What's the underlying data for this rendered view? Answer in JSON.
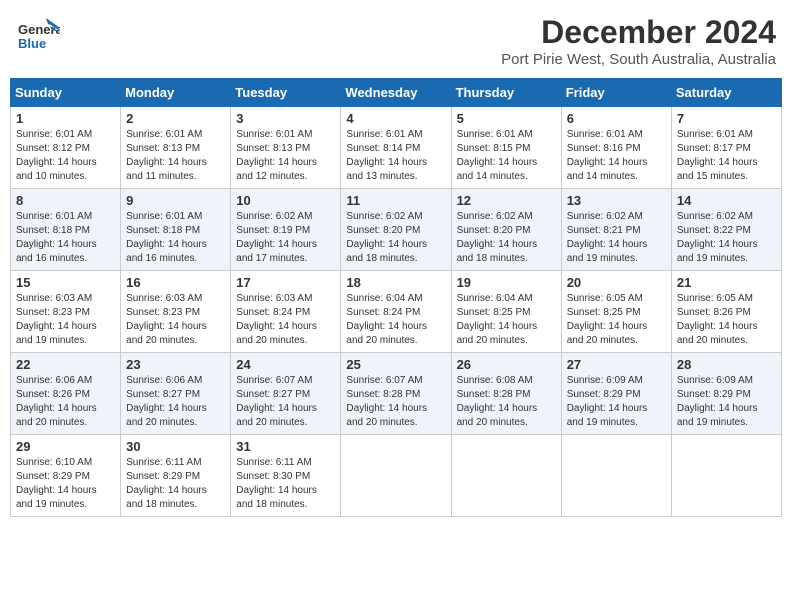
{
  "header": {
    "logo_general": "General",
    "logo_blue": "Blue",
    "title": "December 2024",
    "subtitle": "Port Pirie West, South Australia, Australia"
  },
  "weekdays": [
    "Sunday",
    "Monday",
    "Tuesday",
    "Wednesday",
    "Thursday",
    "Friday",
    "Saturday"
  ],
  "weeks": [
    [
      {
        "day": "1",
        "sunrise": "Sunrise: 6:01 AM",
        "sunset": "Sunset: 8:12 PM",
        "daylight": "Daylight: 14 hours and 10 minutes."
      },
      {
        "day": "2",
        "sunrise": "Sunrise: 6:01 AM",
        "sunset": "Sunset: 8:13 PM",
        "daylight": "Daylight: 14 hours and 11 minutes."
      },
      {
        "day": "3",
        "sunrise": "Sunrise: 6:01 AM",
        "sunset": "Sunset: 8:13 PM",
        "daylight": "Daylight: 14 hours and 12 minutes."
      },
      {
        "day": "4",
        "sunrise": "Sunrise: 6:01 AM",
        "sunset": "Sunset: 8:14 PM",
        "daylight": "Daylight: 14 hours and 13 minutes."
      },
      {
        "day": "5",
        "sunrise": "Sunrise: 6:01 AM",
        "sunset": "Sunset: 8:15 PM",
        "daylight": "Daylight: 14 hours and 14 minutes."
      },
      {
        "day": "6",
        "sunrise": "Sunrise: 6:01 AM",
        "sunset": "Sunset: 8:16 PM",
        "daylight": "Daylight: 14 hours and 14 minutes."
      },
      {
        "day": "7",
        "sunrise": "Sunrise: 6:01 AM",
        "sunset": "Sunset: 8:17 PM",
        "daylight": "Daylight: 14 hours and 15 minutes."
      }
    ],
    [
      {
        "day": "8",
        "sunrise": "Sunrise: 6:01 AM",
        "sunset": "Sunset: 8:18 PM",
        "daylight": "Daylight: 14 hours and 16 minutes."
      },
      {
        "day": "9",
        "sunrise": "Sunrise: 6:01 AM",
        "sunset": "Sunset: 8:18 PM",
        "daylight": "Daylight: 14 hours and 16 minutes."
      },
      {
        "day": "10",
        "sunrise": "Sunrise: 6:02 AM",
        "sunset": "Sunset: 8:19 PM",
        "daylight": "Daylight: 14 hours and 17 minutes."
      },
      {
        "day": "11",
        "sunrise": "Sunrise: 6:02 AM",
        "sunset": "Sunset: 8:20 PM",
        "daylight": "Daylight: 14 hours and 18 minutes."
      },
      {
        "day": "12",
        "sunrise": "Sunrise: 6:02 AM",
        "sunset": "Sunset: 8:20 PM",
        "daylight": "Daylight: 14 hours and 18 minutes."
      },
      {
        "day": "13",
        "sunrise": "Sunrise: 6:02 AM",
        "sunset": "Sunset: 8:21 PM",
        "daylight": "Daylight: 14 hours and 19 minutes."
      },
      {
        "day": "14",
        "sunrise": "Sunrise: 6:02 AM",
        "sunset": "Sunset: 8:22 PM",
        "daylight": "Daylight: 14 hours and 19 minutes."
      }
    ],
    [
      {
        "day": "15",
        "sunrise": "Sunrise: 6:03 AM",
        "sunset": "Sunset: 8:23 PM",
        "daylight": "Daylight: 14 hours and 19 minutes."
      },
      {
        "day": "16",
        "sunrise": "Sunrise: 6:03 AM",
        "sunset": "Sunset: 8:23 PM",
        "daylight": "Daylight: 14 hours and 20 minutes."
      },
      {
        "day": "17",
        "sunrise": "Sunrise: 6:03 AM",
        "sunset": "Sunset: 8:24 PM",
        "daylight": "Daylight: 14 hours and 20 minutes."
      },
      {
        "day": "18",
        "sunrise": "Sunrise: 6:04 AM",
        "sunset": "Sunset: 8:24 PM",
        "daylight": "Daylight: 14 hours and 20 minutes."
      },
      {
        "day": "19",
        "sunrise": "Sunrise: 6:04 AM",
        "sunset": "Sunset: 8:25 PM",
        "daylight": "Daylight: 14 hours and 20 minutes."
      },
      {
        "day": "20",
        "sunrise": "Sunrise: 6:05 AM",
        "sunset": "Sunset: 8:25 PM",
        "daylight": "Daylight: 14 hours and 20 minutes."
      },
      {
        "day": "21",
        "sunrise": "Sunrise: 6:05 AM",
        "sunset": "Sunset: 8:26 PM",
        "daylight": "Daylight: 14 hours and 20 minutes."
      }
    ],
    [
      {
        "day": "22",
        "sunrise": "Sunrise: 6:06 AM",
        "sunset": "Sunset: 8:26 PM",
        "daylight": "Daylight: 14 hours and 20 minutes."
      },
      {
        "day": "23",
        "sunrise": "Sunrise: 6:06 AM",
        "sunset": "Sunset: 8:27 PM",
        "daylight": "Daylight: 14 hours and 20 minutes."
      },
      {
        "day": "24",
        "sunrise": "Sunrise: 6:07 AM",
        "sunset": "Sunset: 8:27 PM",
        "daylight": "Daylight: 14 hours and 20 minutes."
      },
      {
        "day": "25",
        "sunrise": "Sunrise: 6:07 AM",
        "sunset": "Sunset: 8:28 PM",
        "daylight": "Daylight: 14 hours and 20 minutes."
      },
      {
        "day": "26",
        "sunrise": "Sunrise: 6:08 AM",
        "sunset": "Sunset: 8:28 PM",
        "daylight": "Daylight: 14 hours and 20 minutes."
      },
      {
        "day": "27",
        "sunrise": "Sunrise: 6:09 AM",
        "sunset": "Sunset: 8:29 PM",
        "daylight": "Daylight: 14 hours and 19 minutes."
      },
      {
        "day": "28",
        "sunrise": "Sunrise: 6:09 AM",
        "sunset": "Sunset: 8:29 PM",
        "daylight": "Daylight: 14 hours and 19 minutes."
      }
    ],
    [
      {
        "day": "29",
        "sunrise": "Sunrise: 6:10 AM",
        "sunset": "Sunset: 8:29 PM",
        "daylight": "Daylight: 14 hours and 19 minutes."
      },
      {
        "day": "30",
        "sunrise": "Sunrise: 6:11 AM",
        "sunset": "Sunset: 8:29 PM",
        "daylight": "Daylight: 14 hours and 18 minutes."
      },
      {
        "day": "31",
        "sunrise": "Sunrise: 6:11 AM",
        "sunset": "Sunset: 8:30 PM",
        "daylight": "Daylight: 14 hours and 18 minutes."
      },
      null,
      null,
      null,
      null
    ]
  ]
}
